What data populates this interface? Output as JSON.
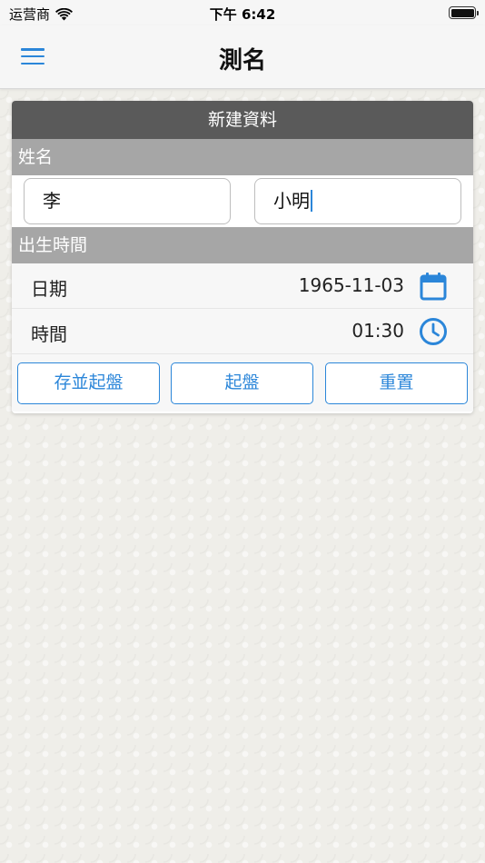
{
  "status_bar": {
    "carrier": "运营商",
    "time": "下午 6:42"
  },
  "nav": {
    "title": "測名"
  },
  "card": {
    "header": "新建資料",
    "name_section": {
      "label": "姓名",
      "surname_value": "李",
      "given_name_value": "小明"
    },
    "birth_section": {
      "label": "出生時間",
      "date_label": "日期",
      "date_value": "1965-11-03",
      "time_label": "時間",
      "time_value": "01:30"
    },
    "buttons": {
      "save_and_calc": "存並起盤",
      "calc": "起盤",
      "reset": "重置"
    }
  },
  "colors": {
    "accent": "#2b86d9",
    "card_header_bg": "#5a5a5a",
    "section_header_bg": "#a6a6a6"
  }
}
